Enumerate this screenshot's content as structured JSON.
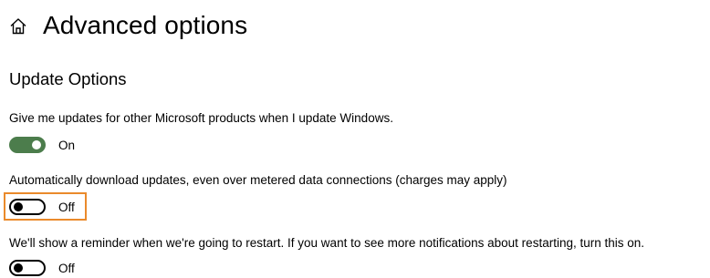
{
  "header": {
    "title": "Advanced options",
    "home_icon": "home-icon"
  },
  "section": {
    "title": "Update Options"
  },
  "settings": [
    {
      "description": "Give me updates for other Microsoft products when I update Windows.",
      "state_label": "On",
      "enabled": true
    },
    {
      "description": "Automatically download updates, even over metered data connections (charges may apply)",
      "state_label": "Off",
      "enabled": false,
      "highlighted": true
    },
    {
      "description": "We'll show a reminder when we're going to restart. If you want to see more notifications about restarting, turn this on.",
      "state_label": "Off",
      "enabled": false
    }
  ],
  "colors": {
    "toggle_on": "#4c7d4c",
    "highlight": "#ea8a2b"
  }
}
